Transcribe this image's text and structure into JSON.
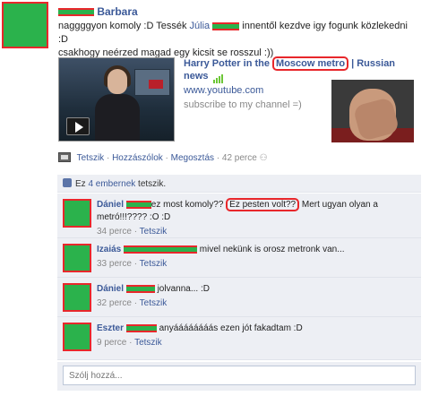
{
  "post": {
    "author": "Barbara",
    "text_part1": "naggggyon komoly :D Tessék ",
    "mention": "Júlia",
    "text_part2": " innentől kezdve igy fogunk közlekedni :D",
    "text_line2": "csakhogy neérzed magad egy kicsit se rosszul :))"
  },
  "video": {
    "title_part1": "Harry Potter in the ",
    "title_highlight": "Moscow metro",
    "title_part2": " | Russian news",
    "url": "www.youtube.com",
    "description": "subscribe to my channel =)"
  },
  "actions": {
    "like": "Tetszik",
    "comment": "Hozzászólok",
    "share": "Megosztás",
    "time": "42 perce",
    "sep": " · "
  },
  "likes": {
    "prefix": "Ez ",
    "link": "4 embernek",
    "suffix": " tetszik."
  },
  "comments": [
    {
      "author": "Dániel",
      "text_before": "ez most komoly?? ",
      "highlight": "Ez pesten volt??",
      "text_after": " Mert ugyan olyan a metró!!!???? :O :D",
      "time": "34 perce",
      "like": "Tetszik"
    },
    {
      "author": "Izaiás",
      "text": " mivel nekünk is orosz metronk van...",
      "time": "33 perce",
      "like": "Tetszik"
    },
    {
      "author": "Dániel",
      "text": " jolvanna... :D",
      "time": "32 perce",
      "like": "Tetszik"
    },
    {
      "author": "Eszter",
      "text": " anyáááááááás ezen jót fakadtam :D",
      "time": "9 perce",
      "like": "Tetszik"
    }
  ],
  "reply": {
    "placeholder": "Szólj hozzá..."
  },
  "colors": {
    "link": "#3b5998",
    "redact_fill": "#2bb24c",
    "redact_border": "#e8272b"
  }
}
